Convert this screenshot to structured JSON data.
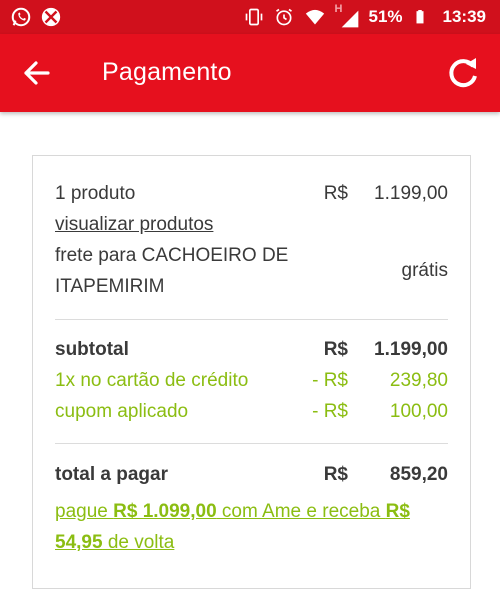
{
  "status_bar": {
    "battery": "51%",
    "time": "13:39",
    "network_label": "H"
  },
  "app_bar": {
    "title": "Pagamento"
  },
  "summary": {
    "products": {
      "label": "1 produto",
      "currency": "R$",
      "value": "1.199,00"
    },
    "view_products_link": "visualizar produtos",
    "shipping": {
      "label_line1": "frete para CACHOEIRO DE",
      "label_line2": "ITAPEMIRIM",
      "value": "grátis"
    },
    "subtotal": {
      "label": "subtotal",
      "currency": "R$",
      "value": "1.199,00"
    },
    "credit_discount": {
      "label": "1x no cartão de crédito",
      "currency": "- R$",
      "value": "239,80"
    },
    "coupon_discount": {
      "label": "cupom aplicado",
      "currency": "- R$",
      "value": "100,00"
    },
    "total": {
      "label": "total a pagar",
      "currency": "R$",
      "value": "859,20"
    },
    "ame_promo": {
      "prefix": "pague ",
      "pay_amount": "R$ 1.099,00",
      "middle": " com Ame e receba ",
      "cashback_currency": "R$",
      "cashback_value": "54,95",
      "suffix": " de volta"
    }
  },
  "colors": {
    "brand_red": "#e6101e",
    "status_red": "#d0101c",
    "discount_green": "#8bbd12"
  },
  "icons": [
    "whatsapp-icon",
    "xbox-icon",
    "vibrate-icon",
    "alarm-icon",
    "wifi-icon",
    "signal-icon",
    "battery-icon",
    "back-arrow-icon",
    "refresh-icon"
  ]
}
